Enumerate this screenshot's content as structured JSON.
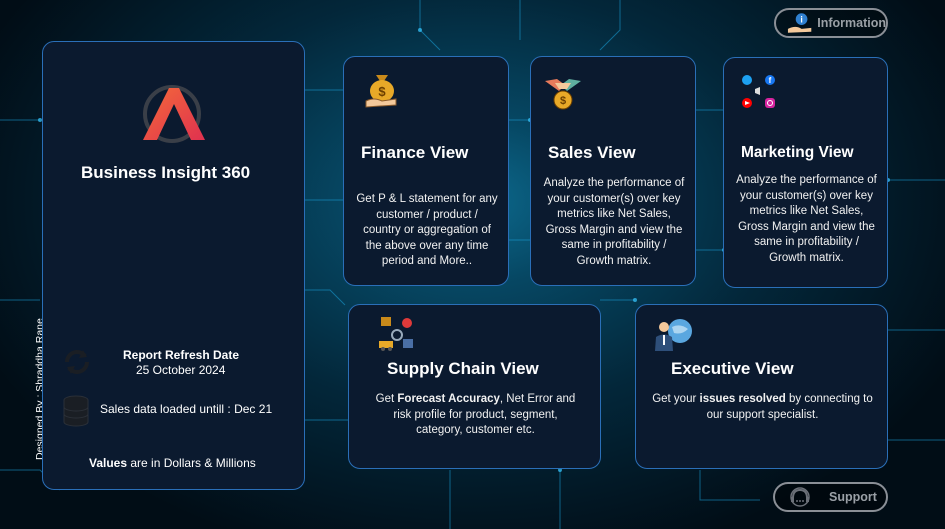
{
  "app": {
    "title": "Business Insight 360",
    "designer": "Designed By : Shraddha Rane"
  },
  "sidebar": {
    "refresh_label": "Report Refresh Date",
    "refresh_date": "25 October 2024",
    "sales_loaded": "Sales data loaded untill : Dec 21",
    "values_bold": "Values",
    "values_rest": " are in Dollars & Millions"
  },
  "buttons": {
    "information": "Information",
    "support": "Support"
  },
  "cards": {
    "finance": {
      "title": "Finance View",
      "desc": "Get  P & L statement for any customer / product / country or aggregation of the above over any time period and More.."
    },
    "sales": {
      "title": "Sales View",
      "desc": "Analyze the performance of your customer(s) over key metrics like Net Sales, Gross Margin and view the same in profitability / Growth matrix."
    },
    "marketing": {
      "title": "Marketing View",
      "desc": "Analyze the performance of your customer(s) over key metrics like Net Sales, Gross Margin and view the same in profitability / Growth matrix."
    },
    "supply": {
      "title": "Supply Chain View",
      "desc_pre": "Get ",
      "desc_bold": "Forecast Accuracy",
      "desc_post": ", Net Error and risk profile for product, segment, category, customer etc."
    },
    "executive": {
      "title": "Executive View",
      "desc_pre": "Get your ",
      "desc_bold": "issues resolved",
      "desc_post": " by connecting to our support specialist."
    }
  },
  "icons": [
    "logo-icon",
    "money-bag-icon",
    "handshake-icon",
    "social-media-icon",
    "supply-chain-icon",
    "executive-icon",
    "refresh-icon",
    "database-icon",
    "info-icon",
    "support-icon"
  ]
}
